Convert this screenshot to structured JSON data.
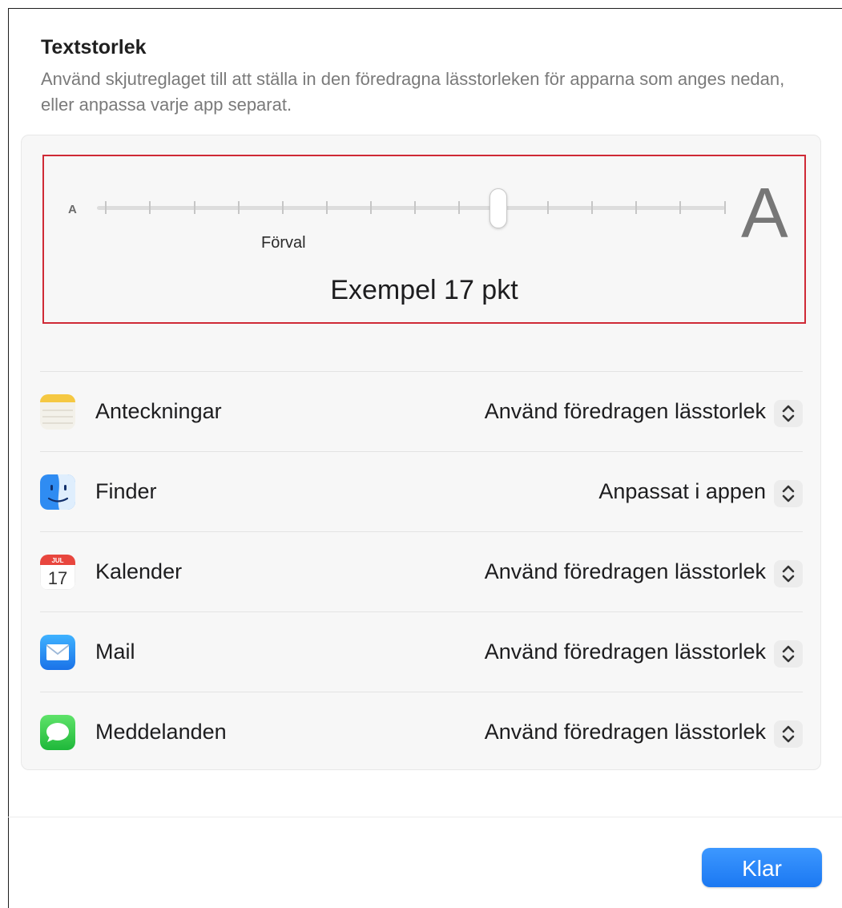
{
  "header": {
    "title": "Textstorlek",
    "description": "Använd skjutreglaget till att ställa in den föredragna lässtorleken för apparna som anges nedan, eller anpassa varje app separat."
  },
  "slider": {
    "min_label": "A",
    "max_label": "A",
    "default_label": "Förval",
    "tick_count": 15,
    "selected_step": 10,
    "sample_text": "Exempel 17 pkt",
    "highlight_color": "#cf2a36"
  },
  "apps": [
    {
      "name": "Anteckningar",
      "icon": "notes-icon",
      "setting": "Använd föredragen lässtorlek"
    },
    {
      "name": "Finder",
      "icon": "finder-icon",
      "setting": "Anpassat i appen"
    },
    {
      "name": "Kalender",
      "icon": "calendar-icon",
      "icon_month": "JUL",
      "icon_day": "17",
      "setting": "Använd föredragen lässtorlek"
    },
    {
      "name": "Mail",
      "icon": "mail-icon",
      "setting": "Använd föredragen lässtorlek"
    },
    {
      "name": "Meddelanden",
      "icon": "messages-icon",
      "setting": "Använd föredragen lässtorlek"
    }
  ],
  "footer": {
    "done_label": "Klar",
    "accent_color": "#1b78f2"
  }
}
